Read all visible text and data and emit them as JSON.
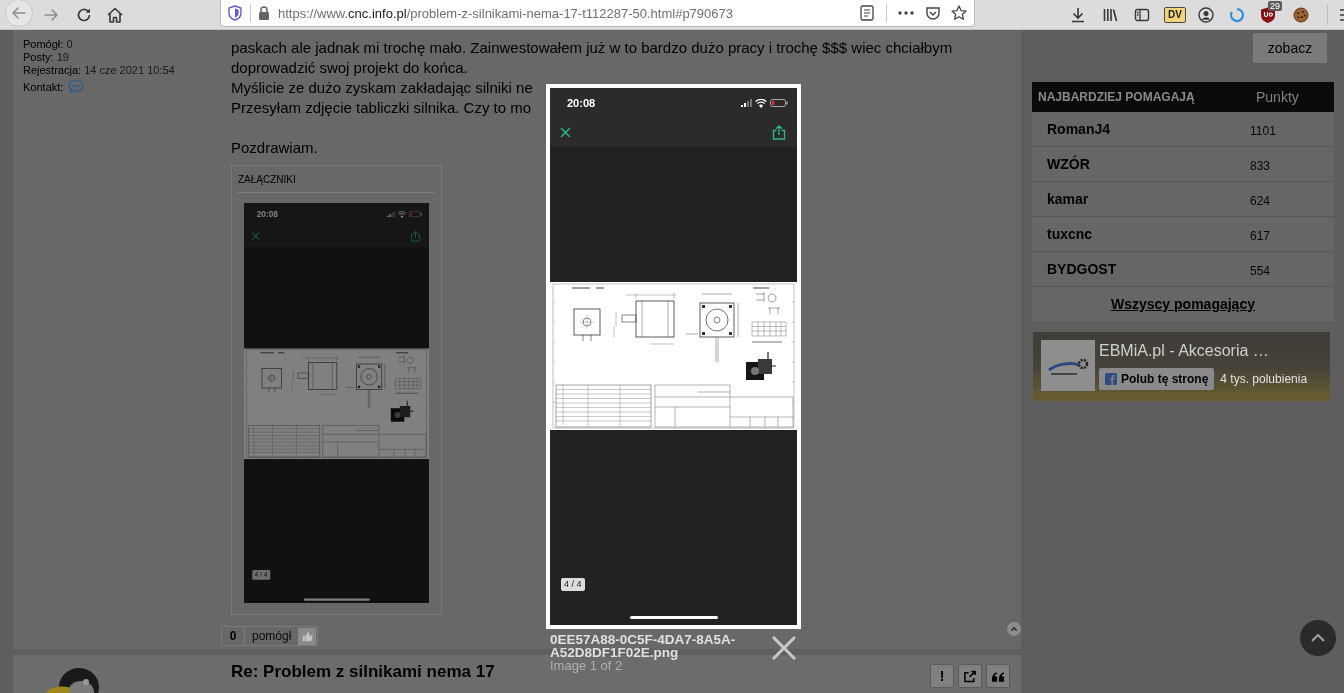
{
  "browser": {
    "url": {
      "scheme": "https://www.",
      "domain": "cnc.info.pl",
      "path": "/problem-z-silnikami-nema-17-t112287-50.html#p790673"
    },
    "extension_label": "DV",
    "blocker_badge": "29"
  },
  "post": {
    "author_stats": [
      {
        "label": "Pomógł:",
        "value": "0"
      },
      {
        "label": "Posty:",
        "value": "19"
      },
      {
        "label": "Rejestracja:",
        "value": "14 cze 2021 10:54"
      }
    ],
    "contact_label": "Kontakt:",
    "lines": [
      "paskach ale jadnak mi trochę mało. Zainwestowałem już w to bardzo dużo pracy i trochę $$$ wiec chciałbym",
      "doprowadzić swoj projekt do końca.",
      "Myślicie ze dużo zyskam zakładając silniki ne",
      "Przesyłam zdjęcie tabliczki silnika. Czy to mo"
    ],
    "closing": "Pozdrawiam.",
    "attachments": {
      "heading": "ZAŁĄCZNIKI",
      "thumbnail": {
        "time": "20:08",
        "counter": "4 / 4"
      }
    },
    "helped": {
      "count": "0",
      "label": "pomógł"
    }
  },
  "next_post": {
    "title": "Re: Problem z silnikami nema 17",
    "actions": [
      {
        "kind": "report",
        "label": "!"
      },
      {
        "kind": "share"
      },
      {
        "kind": "quote"
      }
    ]
  },
  "sidebar": {
    "button": "zobacz",
    "top_helpers": {
      "heading": "NAJBARDZIEJ POMAGAJĄ",
      "points_heading": "Punkty",
      "rows": [
        {
          "name": "RomanJ4",
          "points": "1101"
        },
        {
          "name": "WZÓR",
          "points": "833"
        },
        {
          "name": "kamar",
          "points": "624"
        },
        {
          "name": "tuxcnc",
          "points": "617"
        },
        {
          "name": "BYDGOST",
          "points": "554"
        }
      ],
      "all_link": "Wszyscy pomagający"
    },
    "facebook": {
      "page_name": "EBMiA.pl - Akcesoria …",
      "like_button": "Polub tę stronę",
      "likes": "4 tys. polubienia"
    }
  },
  "lightbox": {
    "image": {
      "time": "20:08",
      "counter": "4 / 4"
    },
    "filename": "0EE57A88-0C5F-4DA7-8A5A-A52D8DF1F02E.png",
    "caption": "Image 1 of 2"
  }
}
